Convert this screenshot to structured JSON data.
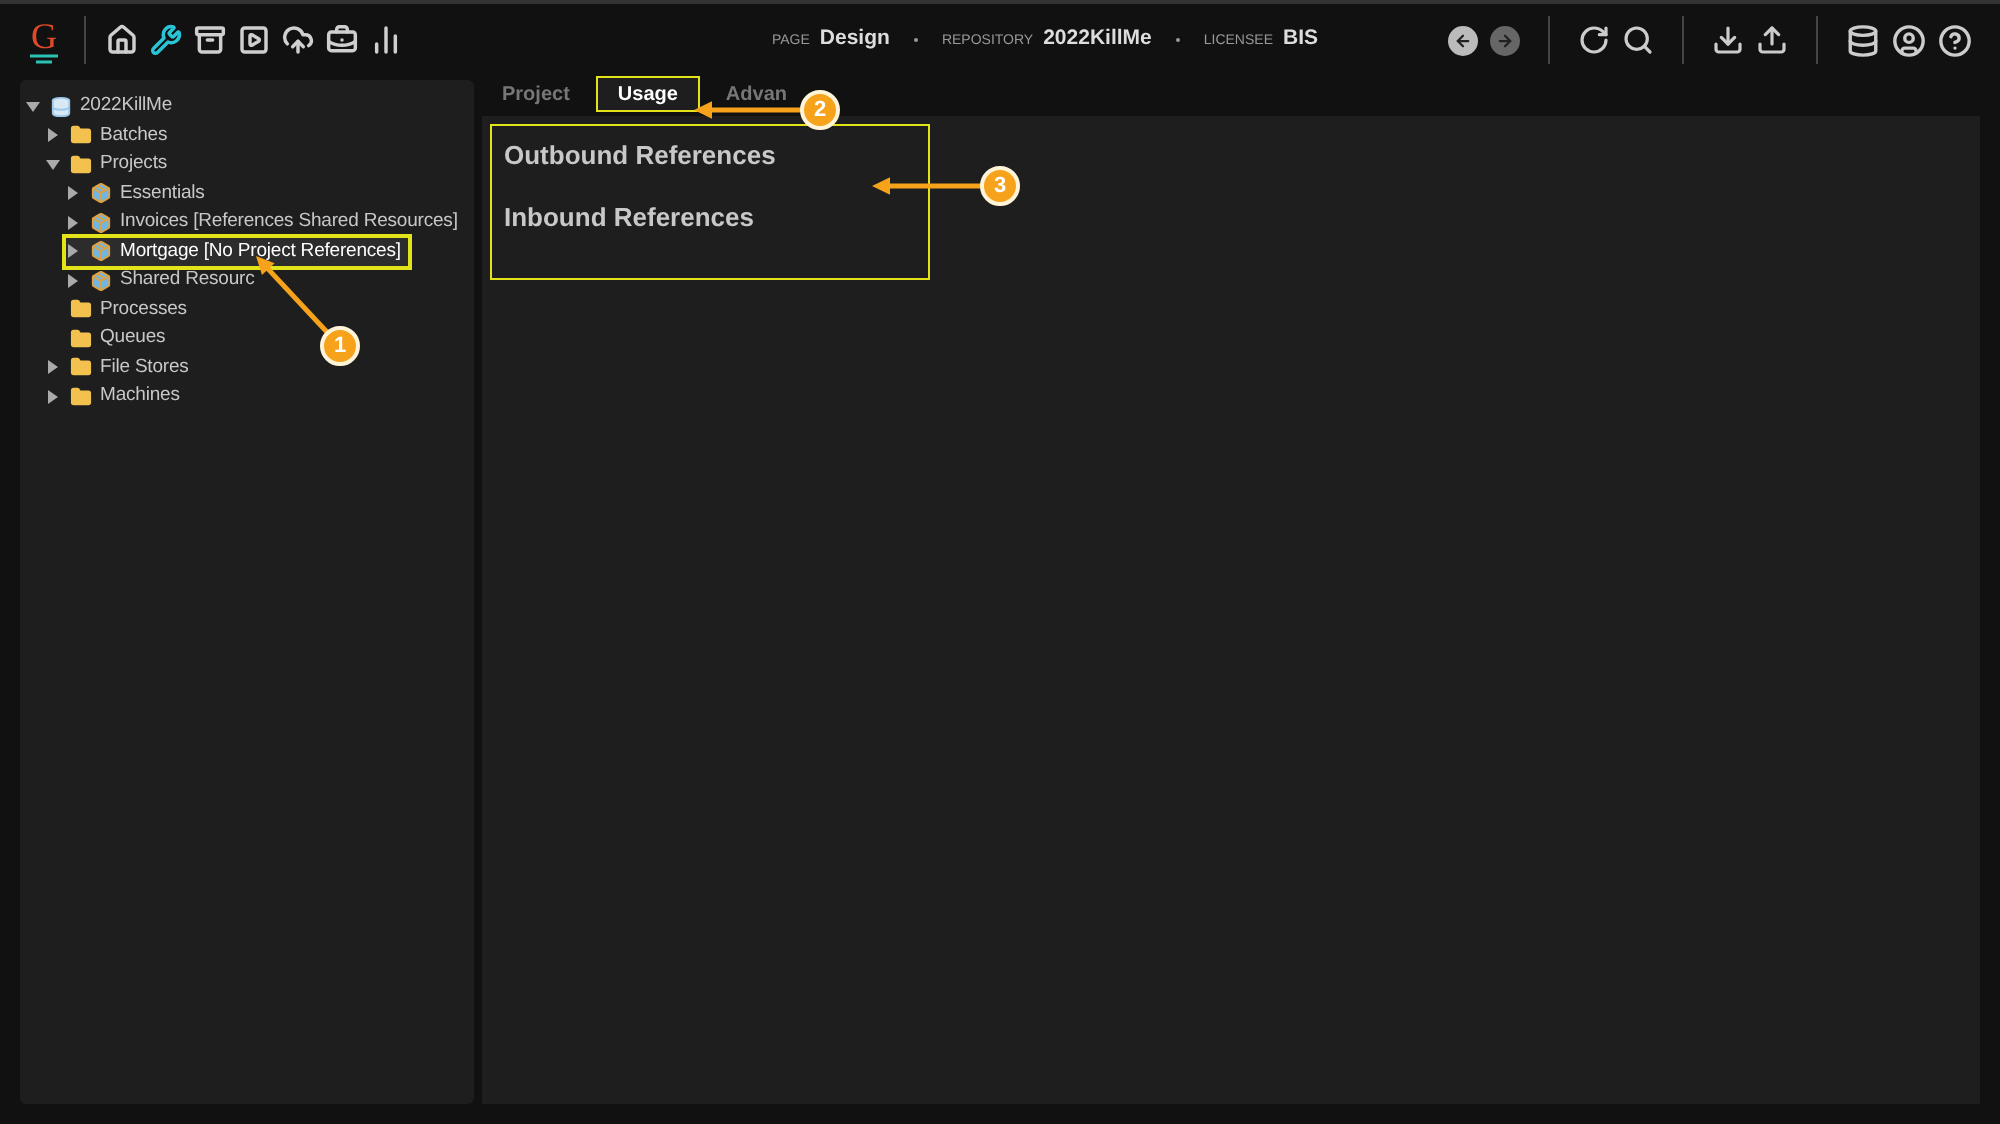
{
  "header": {
    "logo": "G",
    "context": [
      {
        "label": "PAGE",
        "value": "Design"
      },
      {
        "label": "REPOSITORY",
        "value": "2022KillMe"
      },
      {
        "label": "LICENSEE",
        "value": "BIS"
      }
    ]
  },
  "tree": [
    {
      "label": "2022KillMe",
      "kind": "repository",
      "expandable": true,
      "expanded": true,
      "selected": false,
      "children": [
        {
          "label": "Batches",
          "kind": "folder",
          "expandable": true,
          "expanded": false,
          "selected": false
        },
        {
          "label": "Projects",
          "kind": "folder",
          "expandable": true,
          "expanded": true,
          "selected": false,
          "children": [
            {
              "label": "Essentials",
              "kind": "project",
              "expandable": true,
              "expanded": false,
              "selected": false
            },
            {
              "label": "Invoices [References Shared Resources]",
              "kind": "project",
              "expandable": true,
              "expanded": false,
              "selected": false
            },
            {
              "label": "Mortgage [No Project References]",
              "kind": "project",
              "expandable": true,
              "expanded": false,
              "selected": true
            },
            {
              "label": "Shared Resourc",
              "kind": "project",
              "expandable": true,
              "expanded": false,
              "selected": false
            }
          ]
        },
        {
          "label": "Processes",
          "kind": "folder",
          "expandable": false,
          "expanded": false,
          "selected": false
        },
        {
          "label": "Queues",
          "kind": "folder",
          "expandable": false,
          "expanded": false,
          "selected": false
        },
        {
          "label": "File Stores",
          "kind": "folder",
          "expandable": true,
          "expanded": false,
          "selected": false
        },
        {
          "label": "Machines",
          "kind": "folder",
          "expandable": true,
          "expanded": false,
          "selected": false
        }
      ]
    }
  ],
  "tabs": [
    {
      "label": "Project",
      "selected": false
    },
    {
      "label": "Usage",
      "selected": true
    },
    {
      "label": "Advan",
      "selected": false
    }
  ],
  "sections": [
    "Outbound References",
    "Inbound References"
  ],
  "callouts": [
    {
      "number": "1"
    },
    {
      "number": "2"
    },
    {
      "number": "3"
    }
  ]
}
